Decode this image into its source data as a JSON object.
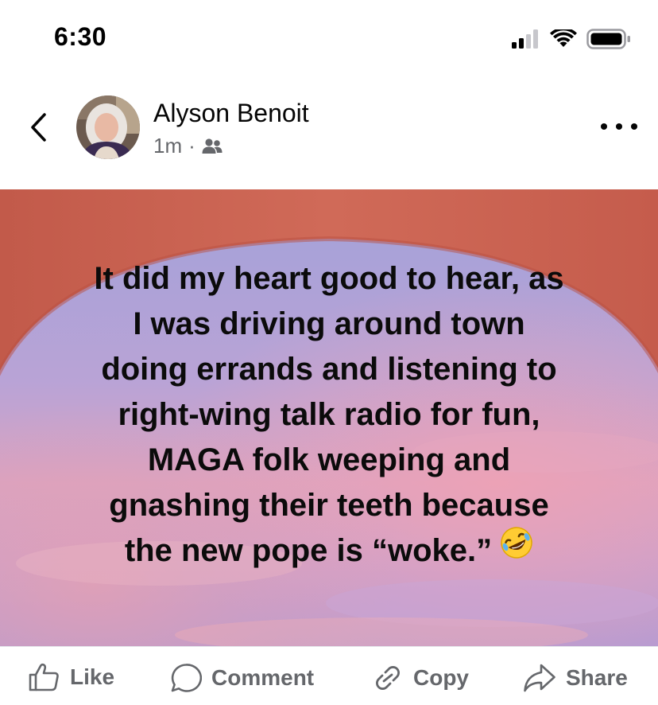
{
  "status_bar": {
    "time": "6:30"
  },
  "post": {
    "author": "Alyson Benoit",
    "timestamp": "1m",
    "separator": "·",
    "audience_icon": "friends-icon",
    "text_lines": [
      "It did my heart good to hear, as",
      "I was driving around town",
      "doing errands and listening to",
      "right-wing talk radio for fun,",
      "MAGA folk weeping and",
      "gnashing their teeth because",
      "the new pope is “woke.”"
    ],
    "emoji": "rolling-on-floor-laughing-emoji",
    "text_color": "#0b0b0b"
  },
  "actions": {
    "like": "Like",
    "comment": "Comment",
    "copy": "Copy",
    "share": "Share"
  },
  "colors": {
    "meta_gray": "#65676b",
    "text_dark": "#050505"
  }
}
